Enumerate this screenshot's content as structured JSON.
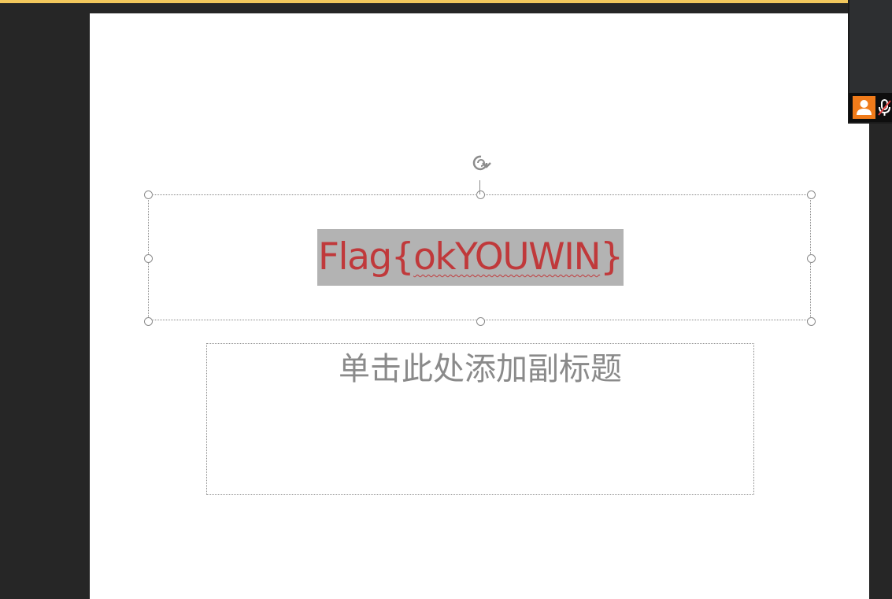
{
  "slide": {
    "title": "Flag{okYOUWIN}",
    "title_prefix": "Flag{",
    "title_body": "okYOUWIN",
    "title_suffix": "}",
    "subtitle_placeholder": "单击此处添加副标题"
  },
  "icons": {
    "rotate": "rotate-handle-icon",
    "avatar": "user-avatar-icon",
    "mic": "mic-muted-icon"
  },
  "colors": {
    "title_text": "#c0393b",
    "title_highlight": "#b3b3b3",
    "placeholder_text": "#8a8a8a",
    "top_accent": "#f2c75c",
    "avatar_bg": "#f07b1a",
    "app_background": "#262626"
  }
}
